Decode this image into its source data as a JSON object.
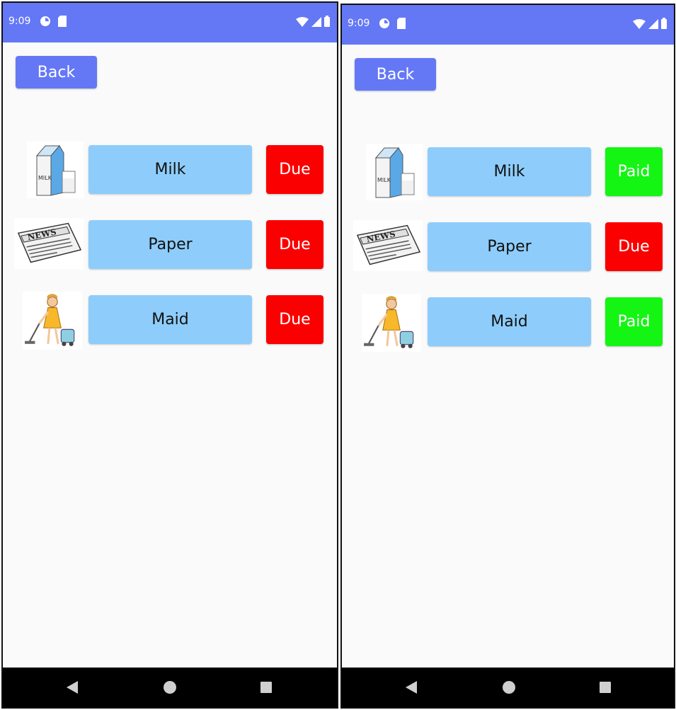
{
  "colors": {
    "status_bar": "#6478f5",
    "item_button": "#8ecdfb",
    "due": "#fb0000",
    "paid": "#14f514",
    "nav_bar": "#000000"
  },
  "screens": [
    {
      "status": {
        "time": "9:09",
        "left_icons": [
          "data-saver-icon",
          "sim-card-icon"
        ],
        "right_icons": [
          "wifi-icon",
          "signal-icon",
          "battery-icon"
        ]
      },
      "back_label": "Back",
      "items": [
        {
          "label": "Milk",
          "icon": "milk-carton-icon",
          "status": "Due"
        },
        {
          "label": "Paper",
          "icon": "newspaper-icon",
          "status": "Due"
        },
        {
          "label": "Maid",
          "icon": "maid-vacuum-icon",
          "status": "Due"
        }
      ],
      "nav": [
        "back-nav-icon",
        "home-nav-icon",
        "recents-nav-icon"
      ]
    },
    {
      "status": {
        "time": "9:09",
        "left_icons": [
          "data-saver-icon",
          "sim-card-icon"
        ],
        "right_icons": [
          "wifi-icon",
          "signal-icon",
          "battery-icon"
        ]
      },
      "back_label": "Back",
      "items": [
        {
          "label": "Milk",
          "icon": "milk-carton-icon",
          "status": "Paid"
        },
        {
          "label": "Paper",
          "icon": "newspaper-icon",
          "status": "Due"
        },
        {
          "label": "Maid",
          "icon": "maid-vacuum-icon",
          "status": "Paid"
        }
      ],
      "nav": [
        "back-nav-icon",
        "home-nav-icon",
        "recents-nav-icon"
      ]
    }
  ]
}
